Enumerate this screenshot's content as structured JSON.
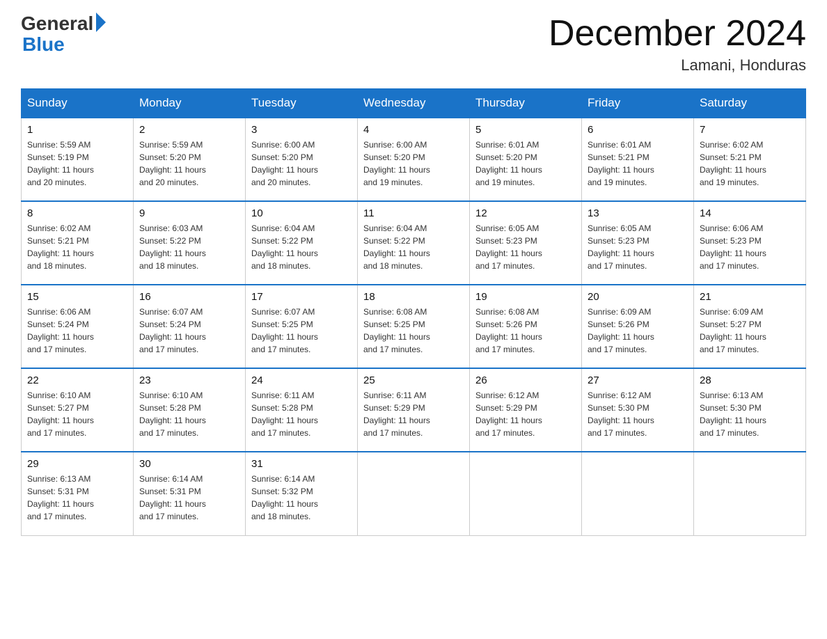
{
  "header": {
    "logo_general": "General",
    "logo_blue": "Blue",
    "month_title": "December 2024",
    "location": "Lamani, Honduras"
  },
  "days_of_week": [
    "Sunday",
    "Monday",
    "Tuesday",
    "Wednesday",
    "Thursday",
    "Friday",
    "Saturday"
  ],
  "weeks": [
    [
      {
        "day": "1",
        "sunrise": "5:59 AM",
        "sunset": "5:19 PM",
        "daylight": "11 hours and 20 minutes."
      },
      {
        "day": "2",
        "sunrise": "5:59 AM",
        "sunset": "5:20 PM",
        "daylight": "11 hours and 20 minutes."
      },
      {
        "day": "3",
        "sunrise": "6:00 AM",
        "sunset": "5:20 PM",
        "daylight": "11 hours and 20 minutes."
      },
      {
        "day": "4",
        "sunrise": "6:00 AM",
        "sunset": "5:20 PM",
        "daylight": "11 hours and 19 minutes."
      },
      {
        "day": "5",
        "sunrise": "6:01 AM",
        "sunset": "5:20 PM",
        "daylight": "11 hours and 19 minutes."
      },
      {
        "day": "6",
        "sunrise": "6:01 AM",
        "sunset": "5:21 PM",
        "daylight": "11 hours and 19 minutes."
      },
      {
        "day": "7",
        "sunrise": "6:02 AM",
        "sunset": "5:21 PM",
        "daylight": "11 hours and 19 minutes."
      }
    ],
    [
      {
        "day": "8",
        "sunrise": "6:02 AM",
        "sunset": "5:21 PM",
        "daylight": "11 hours and 18 minutes."
      },
      {
        "day": "9",
        "sunrise": "6:03 AM",
        "sunset": "5:22 PM",
        "daylight": "11 hours and 18 minutes."
      },
      {
        "day": "10",
        "sunrise": "6:04 AM",
        "sunset": "5:22 PM",
        "daylight": "11 hours and 18 minutes."
      },
      {
        "day": "11",
        "sunrise": "6:04 AM",
        "sunset": "5:22 PM",
        "daylight": "11 hours and 18 minutes."
      },
      {
        "day": "12",
        "sunrise": "6:05 AM",
        "sunset": "5:23 PM",
        "daylight": "11 hours and 17 minutes."
      },
      {
        "day": "13",
        "sunrise": "6:05 AM",
        "sunset": "5:23 PM",
        "daylight": "11 hours and 17 minutes."
      },
      {
        "day": "14",
        "sunrise": "6:06 AM",
        "sunset": "5:23 PM",
        "daylight": "11 hours and 17 minutes."
      }
    ],
    [
      {
        "day": "15",
        "sunrise": "6:06 AM",
        "sunset": "5:24 PM",
        "daylight": "11 hours and 17 minutes."
      },
      {
        "day": "16",
        "sunrise": "6:07 AM",
        "sunset": "5:24 PM",
        "daylight": "11 hours and 17 minutes."
      },
      {
        "day": "17",
        "sunrise": "6:07 AM",
        "sunset": "5:25 PM",
        "daylight": "11 hours and 17 minutes."
      },
      {
        "day": "18",
        "sunrise": "6:08 AM",
        "sunset": "5:25 PM",
        "daylight": "11 hours and 17 minutes."
      },
      {
        "day": "19",
        "sunrise": "6:08 AM",
        "sunset": "5:26 PM",
        "daylight": "11 hours and 17 minutes."
      },
      {
        "day": "20",
        "sunrise": "6:09 AM",
        "sunset": "5:26 PM",
        "daylight": "11 hours and 17 minutes."
      },
      {
        "day": "21",
        "sunrise": "6:09 AM",
        "sunset": "5:27 PM",
        "daylight": "11 hours and 17 minutes."
      }
    ],
    [
      {
        "day": "22",
        "sunrise": "6:10 AM",
        "sunset": "5:27 PM",
        "daylight": "11 hours and 17 minutes."
      },
      {
        "day": "23",
        "sunrise": "6:10 AM",
        "sunset": "5:28 PM",
        "daylight": "11 hours and 17 minutes."
      },
      {
        "day": "24",
        "sunrise": "6:11 AM",
        "sunset": "5:28 PM",
        "daylight": "11 hours and 17 minutes."
      },
      {
        "day": "25",
        "sunrise": "6:11 AM",
        "sunset": "5:29 PM",
        "daylight": "11 hours and 17 minutes."
      },
      {
        "day": "26",
        "sunrise": "6:12 AM",
        "sunset": "5:29 PM",
        "daylight": "11 hours and 17 minutes."
      },
      {
        "day": "27",
        "sunrise": "6:12 AM",
        "sunset": "5:30 PM",
        "daylight": "11 hours and 17 minutes."
      },
      {
        "day": "28",
        "sunrise": "6:13 AM",
        "sunset": "5:30 PM",
        "daylight": "11 hours and 17 minutes."
      }
    ],
    [
      {
        "day": "29",
        "sunrise": "6:13 AM",
        "sunset": "5:31 PM",
        "daylight": "11 hours and 17 minutes."
      },
      {
        "day": "30",
        "sunrise": "6:14 AM",
        "sunset": "5:31 PM",
        "daylight": "11 hours and 17 minutes."
      },
      {
        "day": "31",
        "sunrise": "6:14 AM",
        "sunset": "5:32 PM",
        "daylight": "11 hours and 18 minutes."
      },
      null,
      null,
      null,
      null
    ]
  ],
  "labels": {
    "sunrise": "Sunrise:",
    "sunset": "Sunset:",
    "daylight": "Daylight:"
  }
}
